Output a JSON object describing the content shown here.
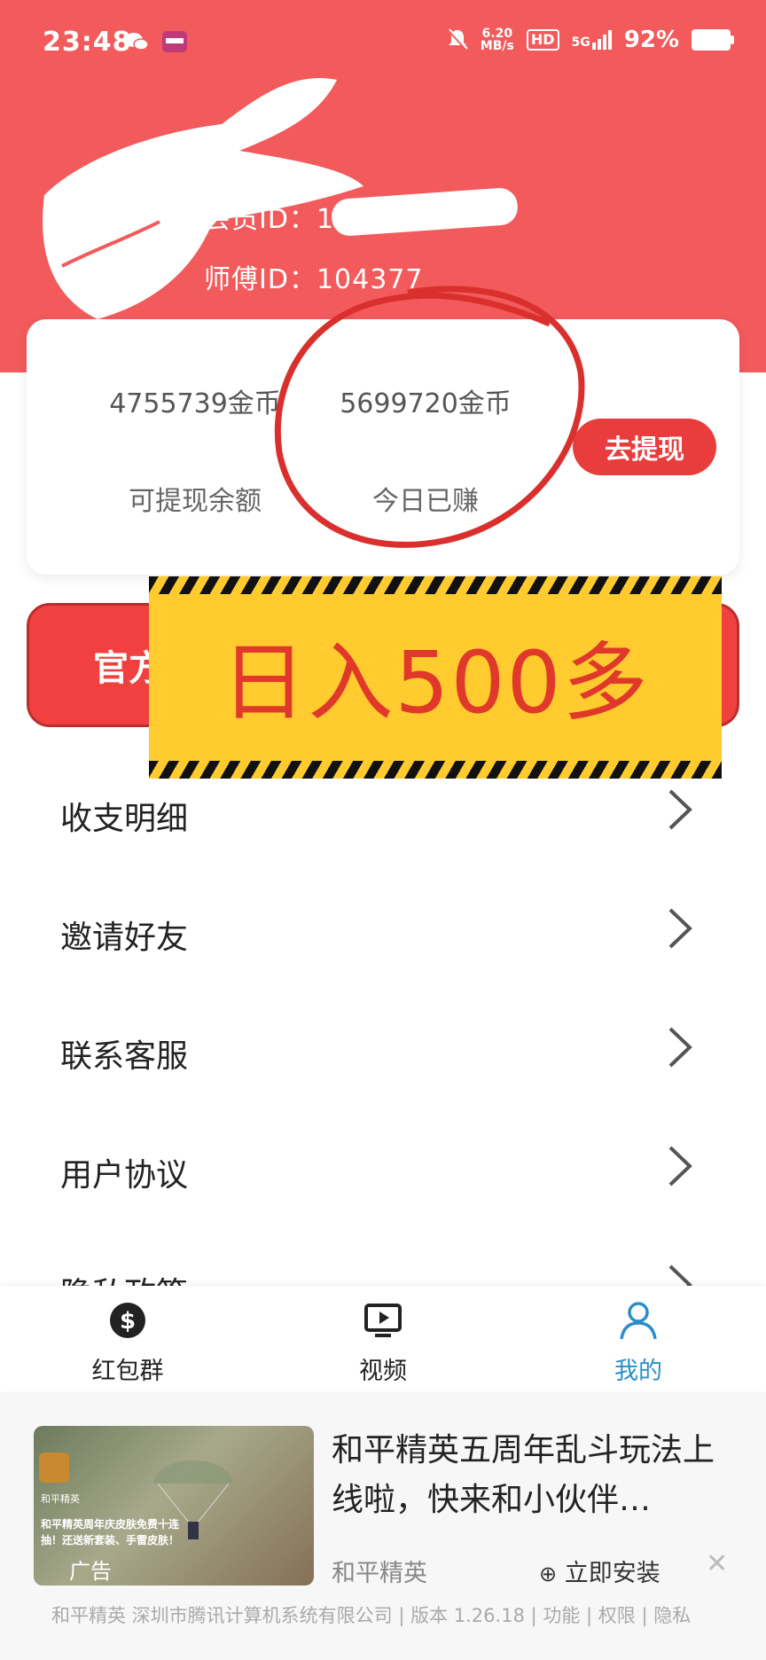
{
  "status_bar": {
    "time": "23:48",
    "net_speed_value": "6.20",
    "net_speed_unit": "MB/s",
    "hd_label": "HD",
    "signal_label": "5G",
    "battery": "92%"
  },
  "profile": {
    "member_id": "会员ID：1",
    "master_id": "师傅ID：104377"
  },
  "balance_card": {
    "withdrawable_value": "4755739金币",
    "withdrawable_label": "可提现余额",
    "today_value": "5699720金币",
    "today_label": "今日已赚",
    "withdraw_button": "去提现"
  },
  "official_button": "官方",
  "banner_text": "日入500多",
  "menu": [
    {
      "label": "收支明细"
    },
    {
      "label": "邀请好友"
    },
    {
      "label": "联系客服"
    },
    {
      "label": "用户协议"
    },
    {
      "label": "隐私政策"
    }
  ],
  "tabbar": [
    {
      "label": "红包群",
      "icon": "dollar-icon",
      "color": "#222222"
    },
    {
      "label": "视频",
      "icon": "tv-icon",
      "color": "#222222"
    },
    {
      "label": "我的",
      "icon": "user-icon",
      "color": "#2a8fc8"
    }
  ],
  "ad": {
    "title": "和平精英五周年乱斗玩法上线啦，快来和小伙伴…",
    "source": "和平精英",
    "install_label": "立即安装",
    "tag": "广告",
    "thumb_brand": "和平精英",
    "thumb_text": "和平精英周年庆皮肤免费十连抽！还送新套装、手雷皮肤！",
    "footer": "和平精英 深圳市腾讯计算机系统有限公司 | 版本 1.26.18 | 功能 | 权限 | 隐私"
  },
  "colors": {
    "header": "#f25a5c",
    "accent_red": "#e93c3c",
    "banner_yellow": "#ffcb2e",
    "banner_text": "#e0382b",
    "active_tab": "#2a8fc8"
  }
}
